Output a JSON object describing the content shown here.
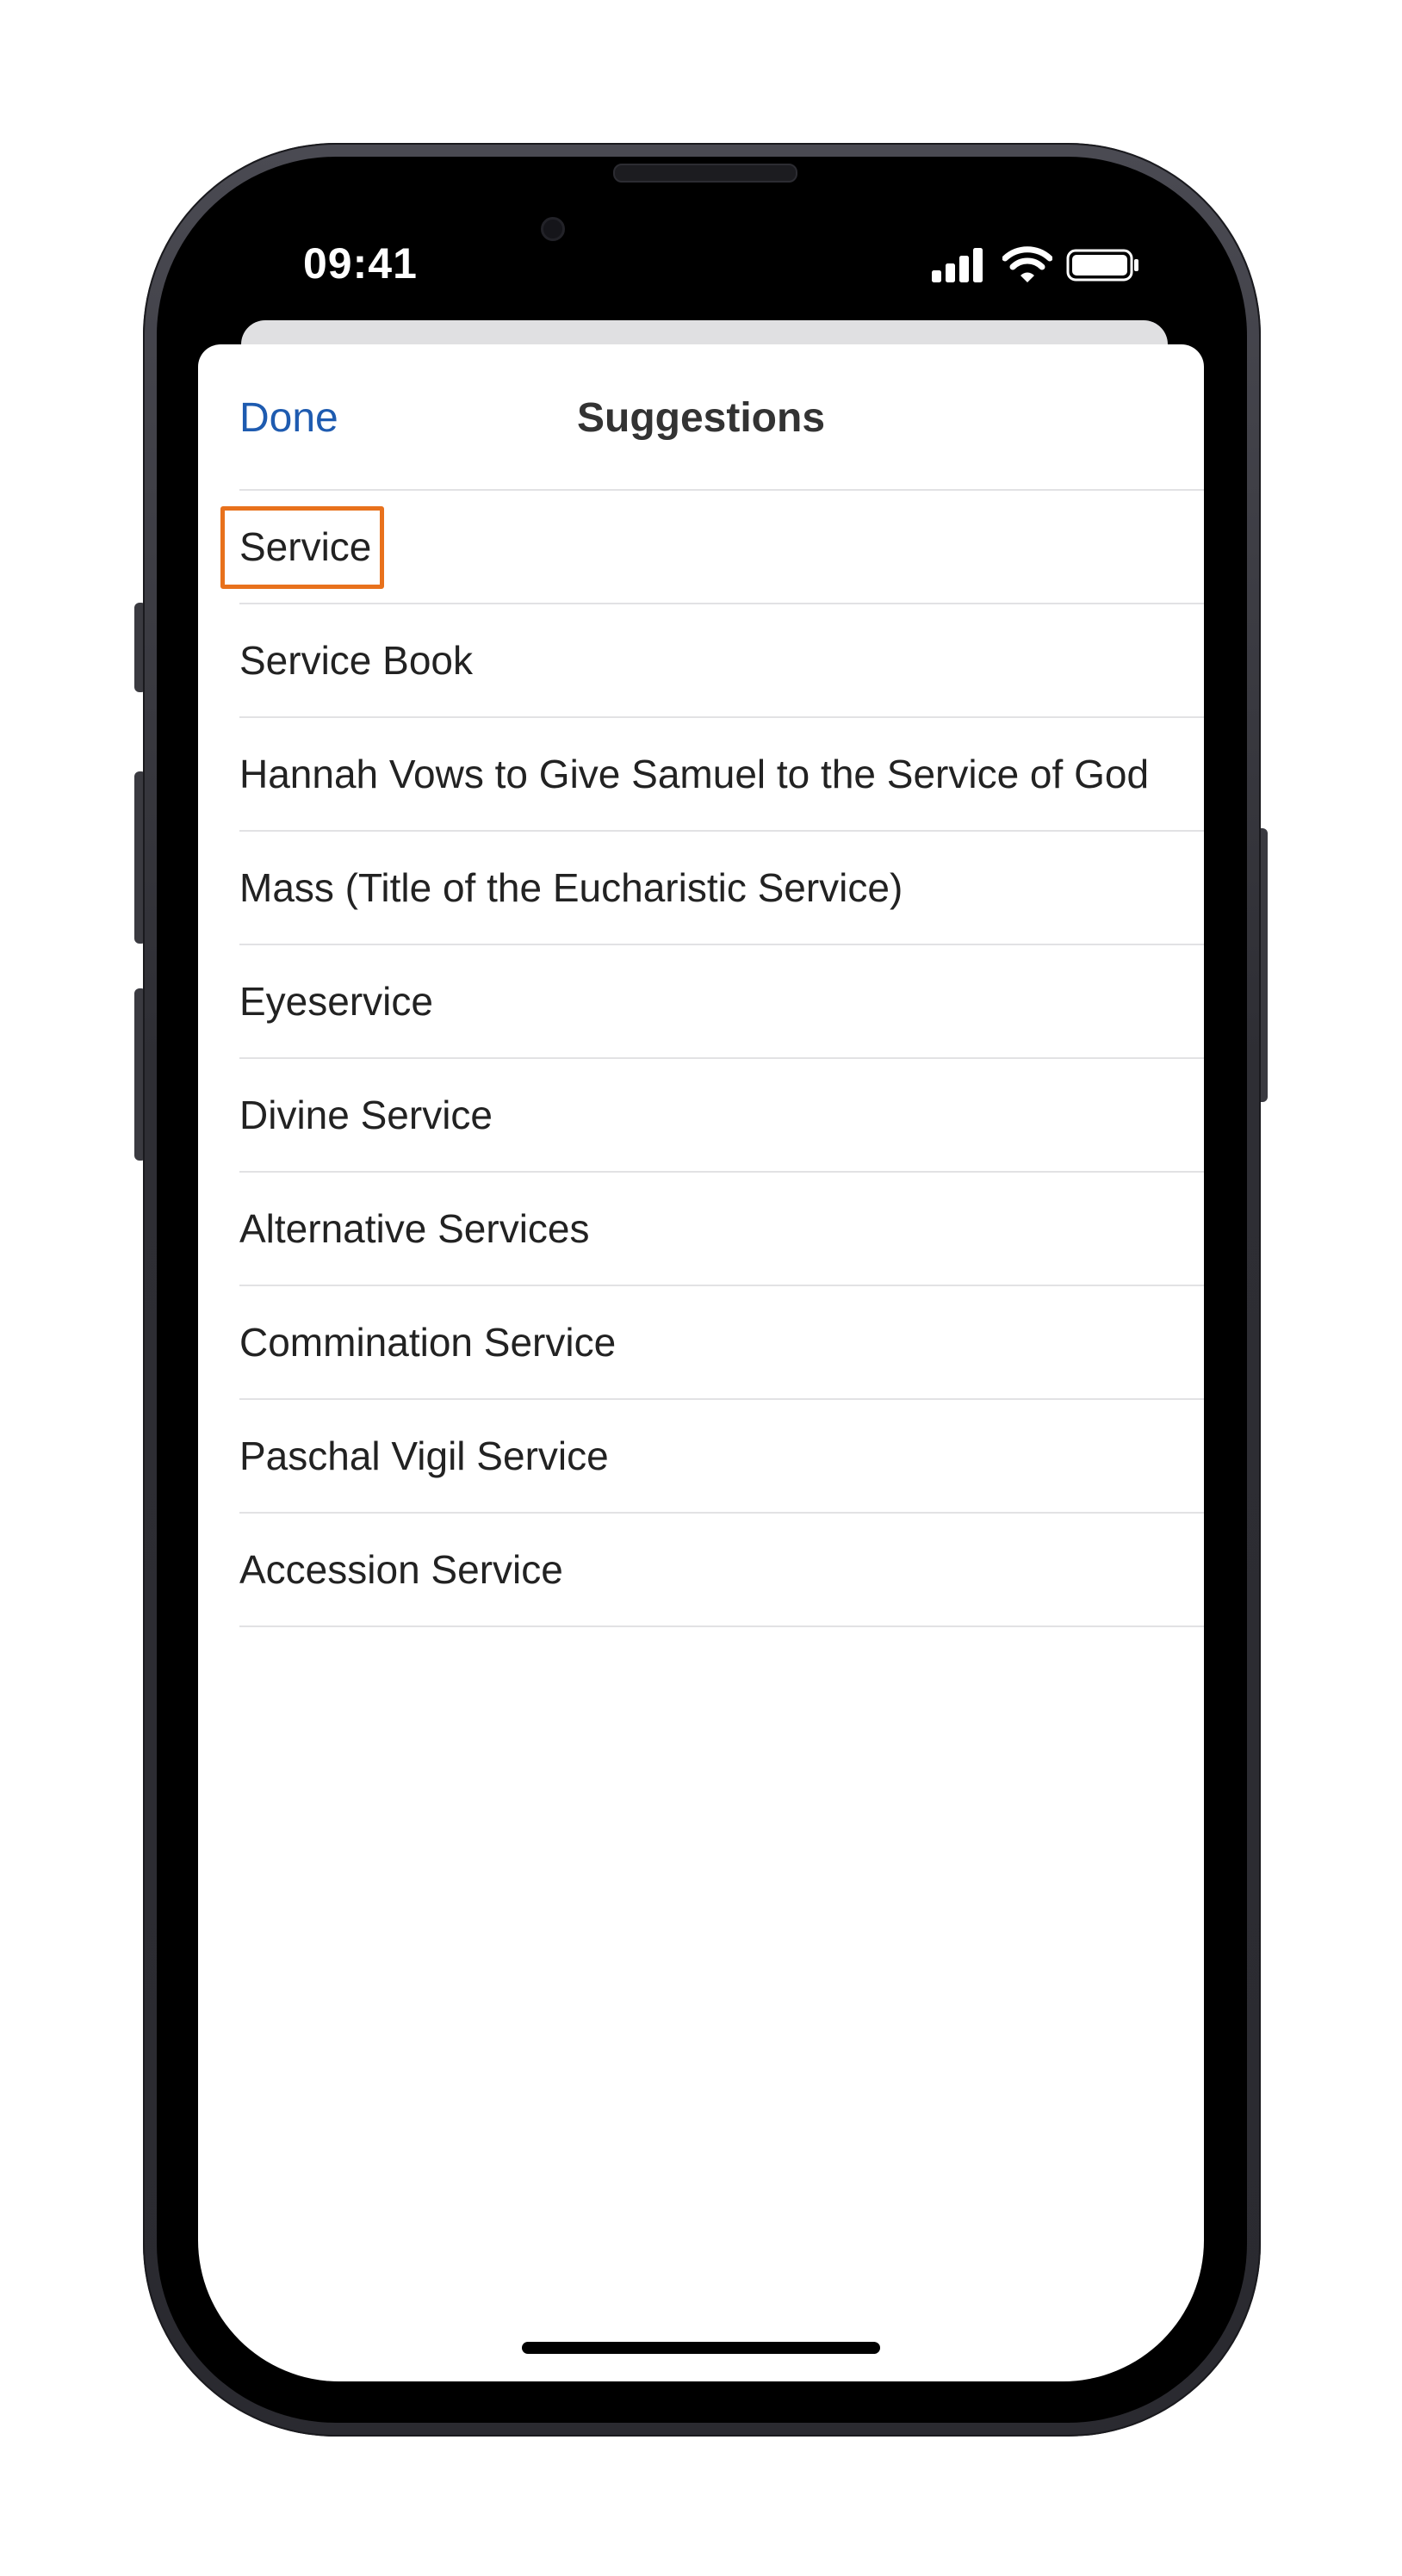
{
  "status_bar": {
    "time": "09:41",
    "icons": [
      "signal-icon",
      "wifi-icon",
      "battery-icon"
    ]
  },
  "nav": {
    "done_label": "Done",
    "title": "Suggestions"
  },
  "suggestions": [
    {
      "label": "Service",
      "highlighted": true
    },
    {
      "label": "Service Book"
    },
    {
      "label": "Hannah Vows to Give Samuel to the Service of God"
    },
    {
      "label": "Mass (Title of the Eucharistic Service)"
    },
    {
      "label": "Eyeservice"
    },
    {
      "label": "Divine Service"
    },
    {
      "label": "Alternative Services"
    },
    {
      "label": "Commination Service"
    },
    {
      "label": "Paschal Vigil Service"
    },
    {
      "label": "Accession Service"
    }
  ],
  "colors": {
    "accent": "#1e5bb0",
    "highlight": "#e8711c",
    "divider": "#e2e2e4",
    "text": "#222222"
  }
}
